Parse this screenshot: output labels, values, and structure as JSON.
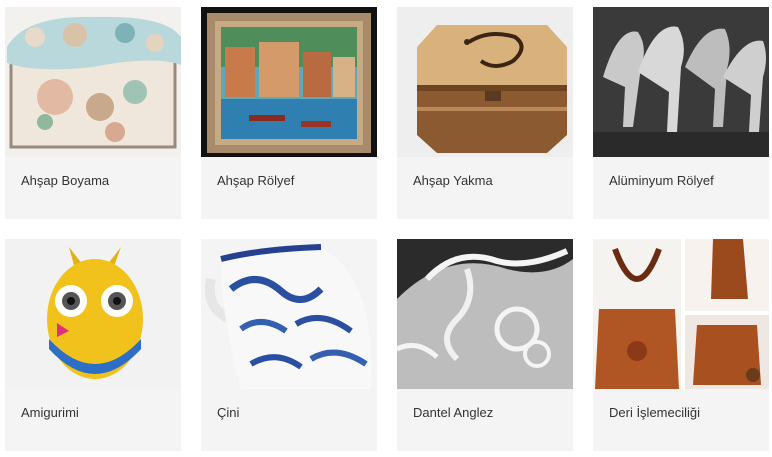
{
  "categories": [
    {
      "title": "Ahşap Boyama",
      "icon": "painted-wood-chest"
    },
    {
      "title": "Ahşap Rölyef",
      "icon": "framed-relief-painting"
    },
    {
      "title": "Ahşap Yakma",
      "icon": "pyrography-wood-box"
    },
    {
      "title": "Alüminyum Rölyef",
      "icon": "aluminium-horses-relief"
    },
    {
      "title": "Amigurimi",
      "icon": "crochet-owl-toy"
    },
    {
      "title": "Çini",
      "icon": "ceramic-jug"
    },
    {
      "title": "Dantel Anglez",
      "icon": "lace-embroidery"
    },
    {
      "title": "Deri İşlemeciliği",
      "icon": "leather-bag"
    }
  ],
  "colors": {
    "card_bg": "#f4f4f4",
    "label_text": "#333333"
  }
}
